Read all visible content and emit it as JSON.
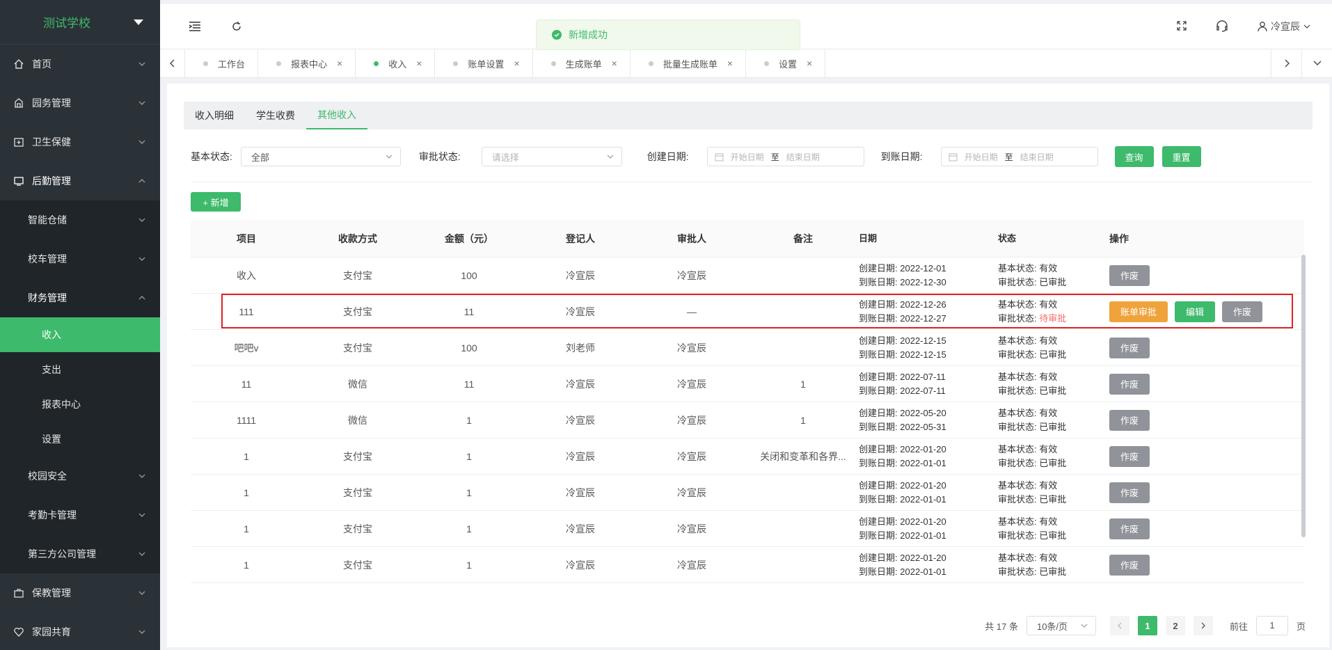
{
  "sidebar": {
    "school": "测试学校",
    "items": [
      {
        "label": "首页"
      },
      {
        "label": "园务管理"
      },
      {
        "label": "卫生保健"
      },
      {
        "label": "后勤管理"
      },
      {
        "label": "智能仓储"
      },
      {
        "label": "校车管理"
      },
      {
        "label": "财务管理"
      },
      {
        "label": "收入"
      },
      {
        "label": "支出"
      },
      {
        "label": "报表中心"
      },
      {
        "label": "设置"
      },
      {
        "label": "校园安全"
      },
      {
        "label": "考勤卡管理"
      },
      {
        "label": "第三方公司管理"
      },
      {
        "label": "保教管理"
      },
      {
        "label": "家园共育"
      }
    ]
  },
  "header": {
    "user": "冷宣辰",
    "toast": "新增成功"
  },
  "tabs": [
    {
      "label": "工作台"
    },
    {
      "label": "报表中心"
    },
    {
      "label": "收入"
    },
    {
      "label": "账单设置"
    },
    {
      "label": "生成账单"
    },
    {
      "label": "批量生成账单"
    },
    {
      "label": "设置"
    }
  ],
  "subtabs": [
    "收入明细",
    "学生收费",
    "其他收入"
  ],
  "filters": {
    "basic_label": "基本状态:",
    "basic_value": "全部",
    "approve_label": "审批状态:",
    "approve_placeholder": "请选择",
    "create_label": "创建日期:",
    "arrive_label": "到账日期:",
    "start_placeholder": "开始日期",
    "to": "至",
    "end_placeholder": "结束日期",
    "query": "查询",
    "reset": "重置"
  },
  "add_label": "+ 新增",
  "table": {
    "headers": [
      "项目",
      "收款方式",
      "金额（元）",
      "登记人",
      "审批人",
      "备注",
      "日期",
      "状态",
      "操作"
    ],
    "create_prefix": "创建日期:",
    "arrive_prefix": "到账日期:",
    "basic_prefix": "基本状态:",
    "approve_prefix": "审批状态:",
    "rows": [
      {
        "item": "收入",
        "method": "支付宝",
        "amount": "100",
        "registrar": "冷宣辰",
        "approver": "冷宣辰",
        "note": "",
        "created": "2022-12-01",
        "arrived": "2022-12-30",
        "basic": "有效",
        "approve": "已审批",
        "actions": [
          "作废"
        ]
      },
      {
        "item": "111",
        "method": "支付宝",
        "amount": "11",
        "registrar": "冷宣辰",
        "approver": "—",
        "note": "",
        "created": "2022-12-26",
        "arrived": "2022-12-27",
        "basic": "有效",
        "approve": "待审批",
        "actions": [
          "账单审批",
          "编辑",
          "作废"
        ]
      },
      {
        "item": "吧吧v",
        "method": "支付宝",
        "amount": "100",
        "registrar": "刘老师",
        "approver": "冷宣辰",
        "note": "",
        "created": "2022-12-15",
        "arrived": "2022-12-15",
        "basic": "有效",
        "approve": "已审批",
        "actions": [
          "作废"
        ]
      },
      {
        "item": "11",
        "method": "微信",
        "amount": "11",
        "registrar": "冷宣辰",
        "approver": "冷宣辰",
        "note": "1",
        "created": "2022-07-11",
        "arrived": "2022-07-11",
        "basic": "有效",
        "approve": "已审批",
        "actions": [
          "作废"
        ]
      },
      {
        "item": "1111",
        "method": "微信",
        "amount": "1",
        "registrar": "冷宣辰",
        "approver": "冷宣辰",
        "note": "1",
        "created": "2022-05-20",
        "arrived": "2022-05-31",
        "basic": "有效",
        "approve": "已审批",
        "actions": [
          "作废"
        ]
      },
      {
        "item": "1",
        "method": "支付宝",
        "amount": "1",
        "registrar": "冷宣辰",
        "approver": "冷宣辰",
        "note": "关闭和变革和各界...",
        "created": "2022-01-20",
        "arrived": "2022-01-01",
        "basic": "有效",
        "approve": "已审批",
        "actions": [
          "作废"
        ]
      },
      {
        "item": "1",
        "method": "支付宝",
        "amount": "1",
        "registrar": "冷宣辰",
        "approver": "冷宣辰",
        "note": "",
        "created": "2022-01-20",
        "arrived": "2022-01-01",
        "basic": "有效",
        "approve": "已审批",
        "actions": [
          "作废"
        ]
      },
      {
        "item": "1",
        "method": "支付宝",
        "amount": "1",
        "registrar": "冷宣辰",
        "approver": "冷宣辰",
        "note": "",
        "created": "2022-01-20",
        "arrived": "2022-01-01",
        "basic": "有效",
        "approve": "已审批",
        "actions": [
          "作废"
        ]
      },
      {
        "item": "1",
        "method": "支付宝",
        "amount": "1",
        "registrar": "冷宣辰",
        "approver": "冷宣辰",
        "note": "",
        "created": "2022-01-20",
        "arrived": "2022-01-01",
        "basic": "有效",
        "approve": "已审批",
        "actions": [
          "作废"
        ]
      }
    ]
  },
  "pagination": {
    "total": "共 17 条",
    "page_size": "10条/页",
    "pages": [
      "1",
      "2"
    ],
    "goto_label": "前往",
    "goto_value": "1",
    "page_unit": "页"
  },
  "colors": {
    "accent": "#3dba6b",
    "sidebar_bg": "#2b3237",
    "audit": "#f0a23b",
    "void": "#909399",
    "pending": "#f56c6c",
    "highlight": "#e02020"
  }
}
